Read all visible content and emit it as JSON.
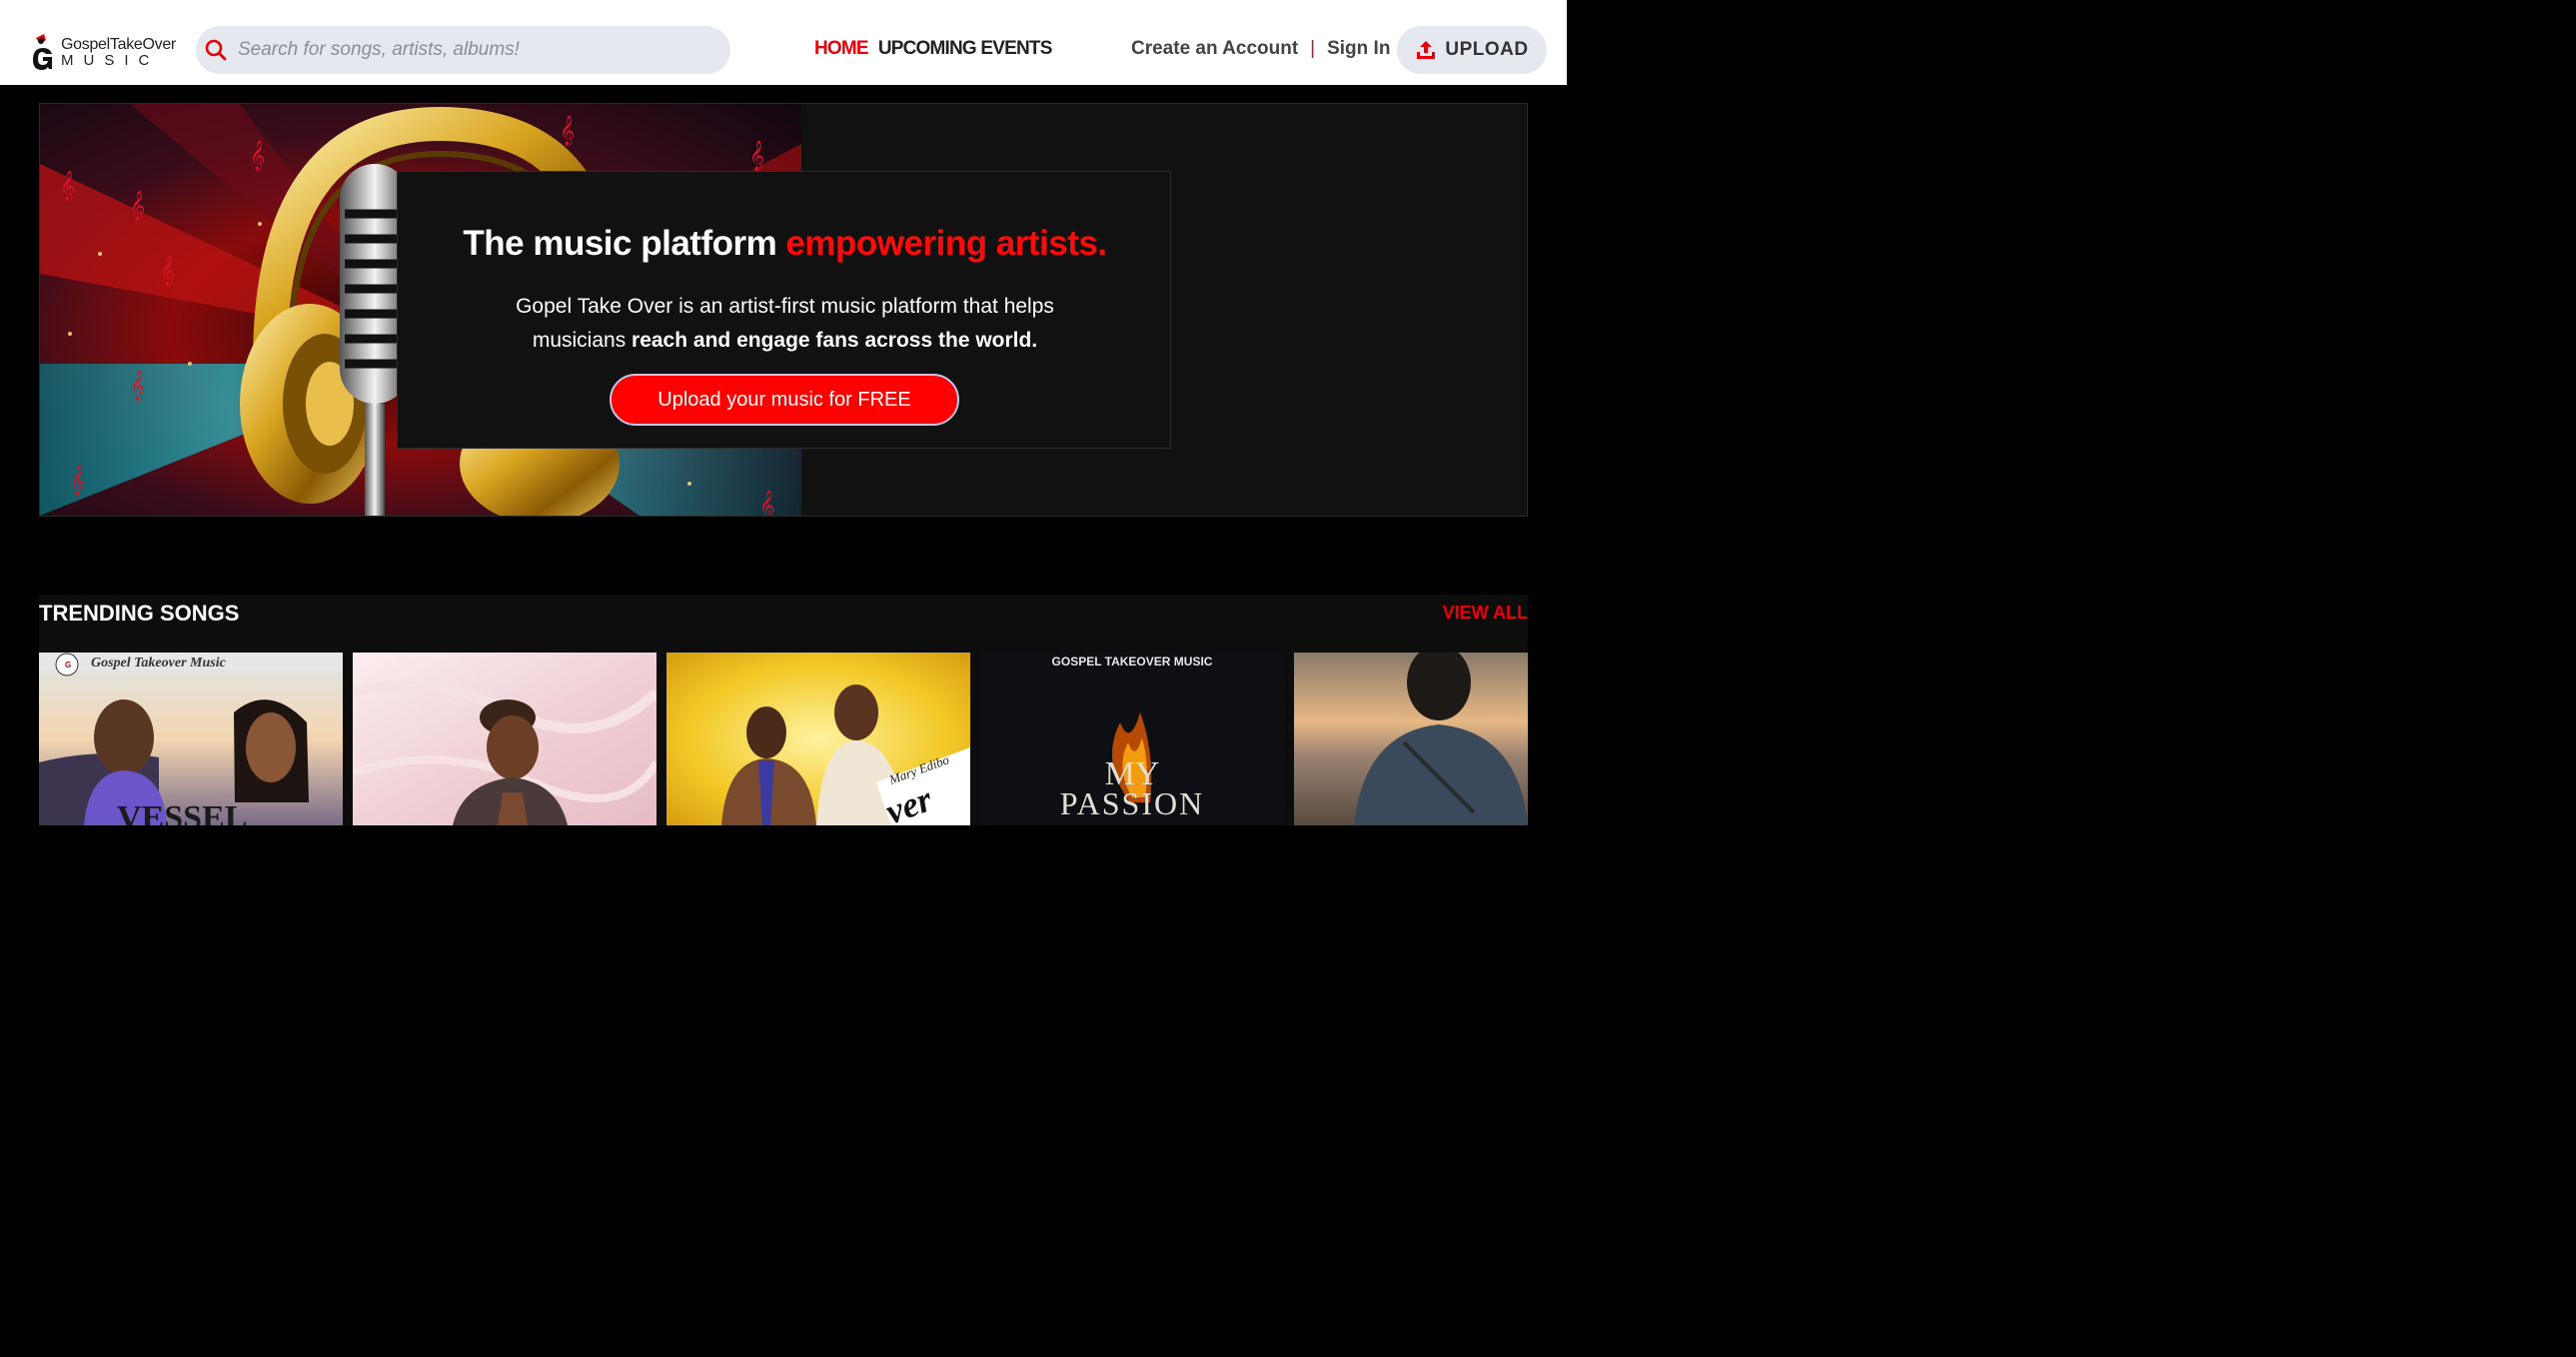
{
  "brand": {
    "logo_line1": "GospelTakeOver",
    "logo_line2": "MUSIC",
    "logo_badge": "GTM",
    "accent_color": "#e8000b"
  },
  "search": {
    "placeholder": "Search for songs, artists, albums!",
    "icon": "search-icon"
  },
  "nav": {
    "home": "HOME",
    "events": "UPCOMING EVENTS"
  },
  "auth": {
    "create": "Create an Account",
    "separator": "|",
    "signin": "Sign In",
    "upload": "UPLOAD"
  },
  "hero": {
    "title_plain": "The music platform ",
    "title_accent": "empowering artists.",
    "text_plain": "Gopel Take Over is an artist-first music platform that helps musicians ",
    "text_bold": "reach and engage fans across the world.",
    "cta": "Upload your music for FREE"
  },
  "trending": {
    "title": "TRENDING SONGS",
    "view_all": "VIEW ALL",
    "cards": [
      {
        "caption_top": "Gospel Takeover Music",
        "caption_bottom": "VESSEL"
      },
      {
        "caption_top": "",
        "caption_bottom": ""
      },
      {
        "caption_top": "",
        "caption_bottom": "ver",
        "signature": "Mary Edibo"
      },
      {
        "caption_top": "GOSPEL TAKEOVER MUSIC",
        "caption_bottom": "MY PASSION",
        "caption_line1": "MY",
        "caption_line2": "PASSION"
      },
      {
        "caption_top": "",
        "caption_bottom": ""
      }
    ]
  }
}
